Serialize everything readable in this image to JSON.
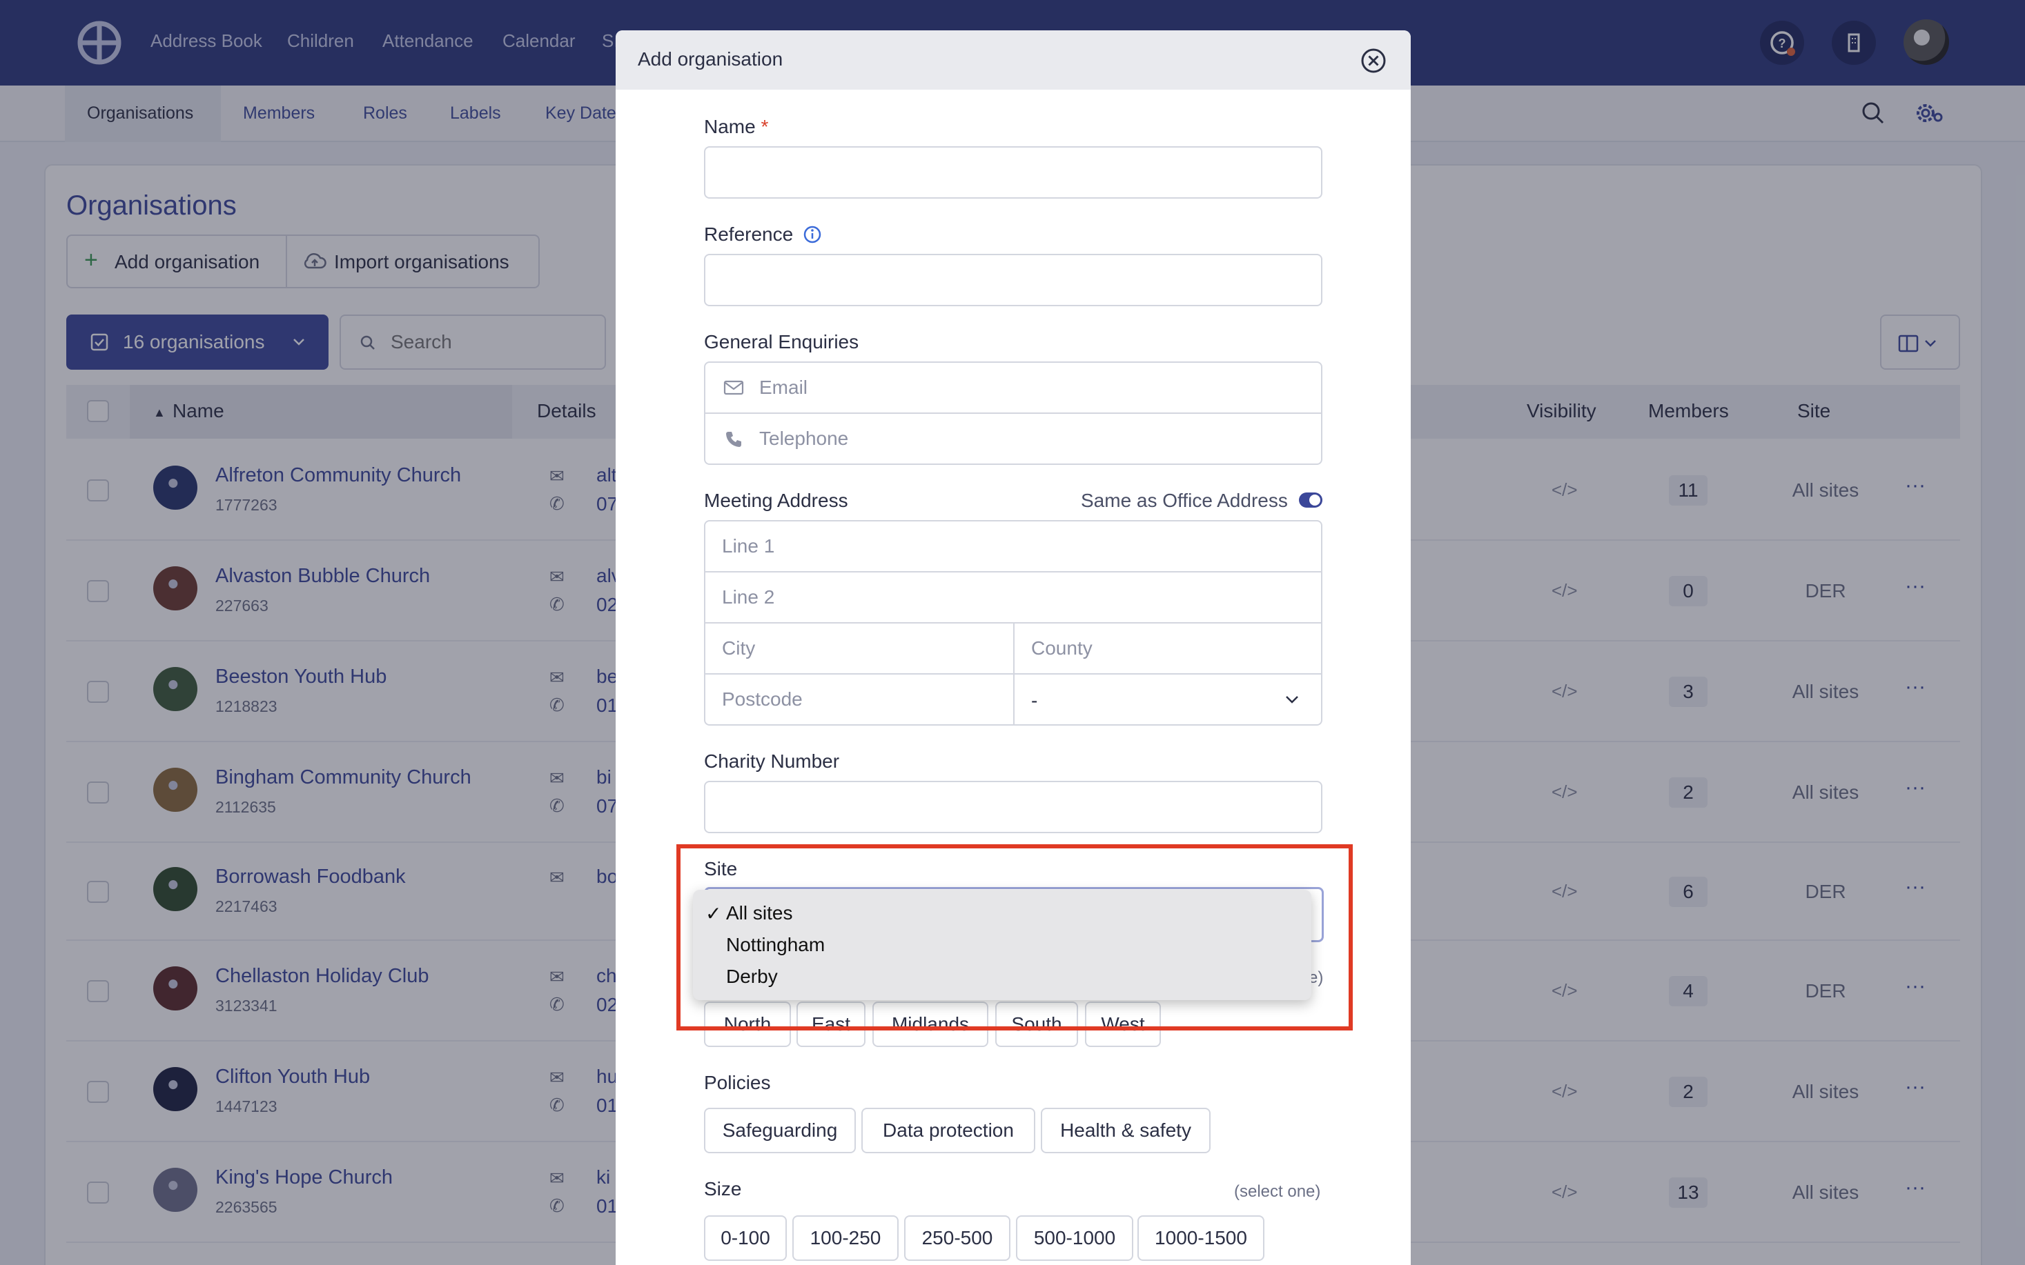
{
  "topnav": {
    "items": [
      "Address Book",
      "Children",
      "Attendance",
      "Calendar",
      "Sı"
    ]
  },
  "subnav": {
    "items": [
      "Organisations",
      "Members",
      "Roles",
      "Labels",
      "Key Date"
    ]
  },
  "page": {
    "title": "Organisations",
    "add_button": "Add organisation",
    "import_button": "Import organisations",
    "count_button": "16 organisations",
    "search_placeholder": "Search"
  },
  "table": {
    "headers": {
      "name": "Name",
      "details": "Details",
      "visibility": "Visibility",
      "members": "Members",
      "site": "Site"
    },
    "rows": [
      {
        "name": "Alfreton Community Church",
        "ref": "1777263",
        "detail1": "alt",
        "detail2": "07",
        "members": "11",
        "site": "All sites",
        "avatar_color": "#27346b"
      },
      {
        "name": "Alvaston Bubble Church",
        "ref": "227663",
        "detail1": "alv",
        "detail2": "02",
        "members": "0",
        "site": "DER",
        "avatar_color": "#6b3a2f"
      },
      {
        "name": "Beeston Youth Hub",
        "ref": "1218823",
        "detail1": "be",
        "detail2": "01",
        "members": "3",
        "site": "All sites",
        "avatar_color": "#3d5a3a"
      },
      {
        "name": "Bingham Community Church",
        "ref": "2112635",
        "detail1": "bi",
        "detail2": "07",
        "members": "2",
        "site": "All sites",
        "avatar_color": "#8a6a3c"
      },
      {
        "name": "Borrowash Foodbank",
        "ref": "2217463",
        "detail1": "bo",
        "detail2": "",
        "members": "6",
        "site": "DER",
        "avatar_color": "#2f4a2c"
      },
      {
        "name": "Chellaston Holiday Club",
        "ref": "3123341",
        "detail1": "ch",
        "detail2": "02",
        "members": "4",
        "site": "DER",
        "avatar_color": "#5b2a2a"
      },
      {
        "name": "Clifton Youth Hub",
        "ref": "1447123",
        "detail1": "hu",
        "detail2": "01",
        "members": "2",
        "site": "All sites",
        "avatar_color": "#1d2140"
      },
      {
        "name": "King's Hope Church",
        "ref": "2263565",
        "detail1": "ki",
        "detail2": "01",
        "members": "13",
        "site": "All sites",
        "avatar_color": "#6d6f8a"
      }
    ]
  },
  "modal": {
    "title": "Add organisation",
    "name_label": "Name",
    "required_mark": "*",
    "reference_label": "Reference",
    "enquiries_label": "General Enquiries",
    "email_placeholder": "Email",
    "telephone_placeholder": "Telephone",
    "meeting_label": "Meeting Address",
    "same_as_label": "Same as Office Address",
    "line1_placeholder": "Line 1",
    "line2_placeholder": "Line 2",
    "city_placeholder": "City",
    "county_placeholder": "County",
    "postcode_placeholder": "Postcode",
    "country_value": "-",
    "charity_label": "Charity Number",
    "site_label": "Site",
    "site_options": [
      "All sites",
      "Nottingham",
      "Derby"
    ],
    "site_selected": "All sites",
    "site_hint_fragment": "e)",
    "region_chips": [
      "North",
      "East",
      "Midlands",
      "South",
      "West"
    ],
    "policies_label": "Policies",
    "policy_chips": [
      "Safeguarding",
      "Data protection",
      "Health & safety"
    ],
    "size_label": "Size",
    "size_hint": "(select one)",
    "size_chips": [
      "0-100",
      "100-250",
      "250-500",
      "500-1000",
      "1000-1500"
    ]
  },
  "colors": {
    "nav_bg": "#2e3a7c",
    "accent": "#3b4799",
    "required": "#d9412b",
    "highlight": "#e03a24"
  }
}
